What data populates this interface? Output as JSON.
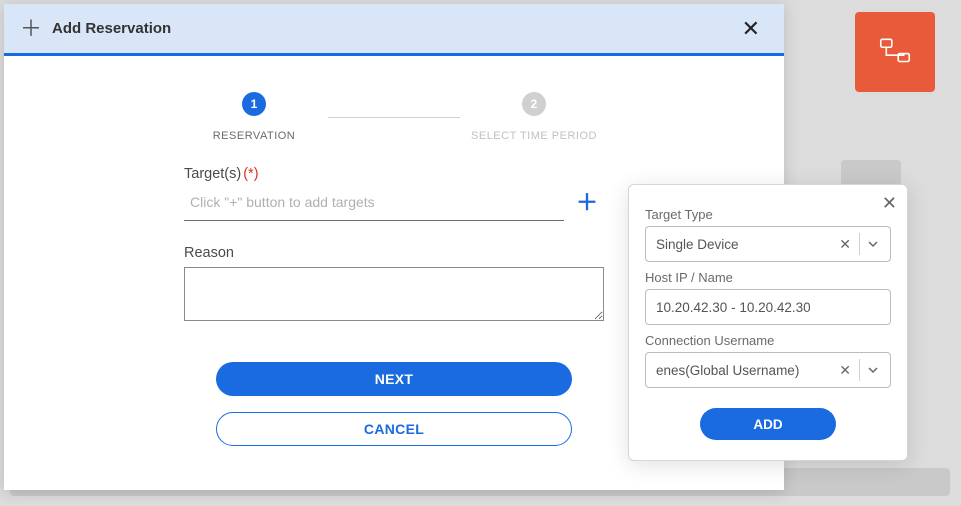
{
  "modal": {
    "title": "Add Reservation",
    "close_glyph": "✕"
  },
  "stepper": {
    "steps": [
      {
        "num": "1",
        "label": "RESERVATION",
        "active": true
      },
      {
        "num": "2",
        "label": "SELECT TIME PERIOD",
        "active": false
      }
    ]
  },
  "targets": {
    "label": "Target(s)",
    "required_mark": "(*)",
    "placeholder": "Click \"+\" button to add targets"
  },
  "reason": {
    "label": "Reason",
    "value": ""
  },
  "buttons": {
    "next": "NEXT",
    "cancel": "CANCEL"
  },
  "popover": {
    "close_glyph": "✕",
    "target_type_label": "Target Type",
    "target_type_value": "Single Device",
    "host_label": "Host IP / Name",
    "host_value": "10.20.42.30 - 10.20.42.30",
    "conn_user_label": "Connection Username",
    "conn_user_value": "enes(Global Username)",
    "add_button": "ADD",
    "clear_glyph": "✕"
  }
}
